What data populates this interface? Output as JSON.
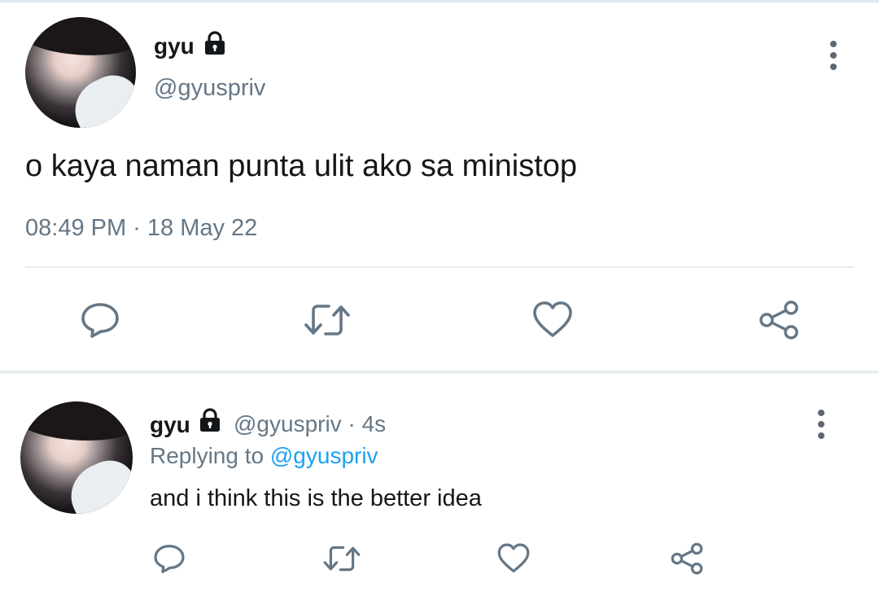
{
  "colors": {
    "text": "#14171a",
    "secondary": "#657786",
    "link": "#1da1f2",
    "divider": "#e6ecf0"
  },
  "main_tweet": {
    "display_name": "gyu",
    "handle": "@gyuspriv",
    "text": "o kaya naman punta ulit ako sa ministop",
    "timestamp": "08:49 PM · 18 May 22",
    "icons": {
      "lock": "lock-icon",
      "more": "more-vertical-icon",
      "reply": "reply-icon",
      "retweet": "retweet-icon",
      "like": "heart-icon",
      "share": "share-icon"
    }
  },
  "reply_tweet": {
    "display_name": "gyu",
    "handle_time": "@gyuspriv · 4s",
    "replying_prefix": "Replying to",
    "replying_handle": "@gyuspriv",
    "text": "and i think this is the better idea"
  }
}
